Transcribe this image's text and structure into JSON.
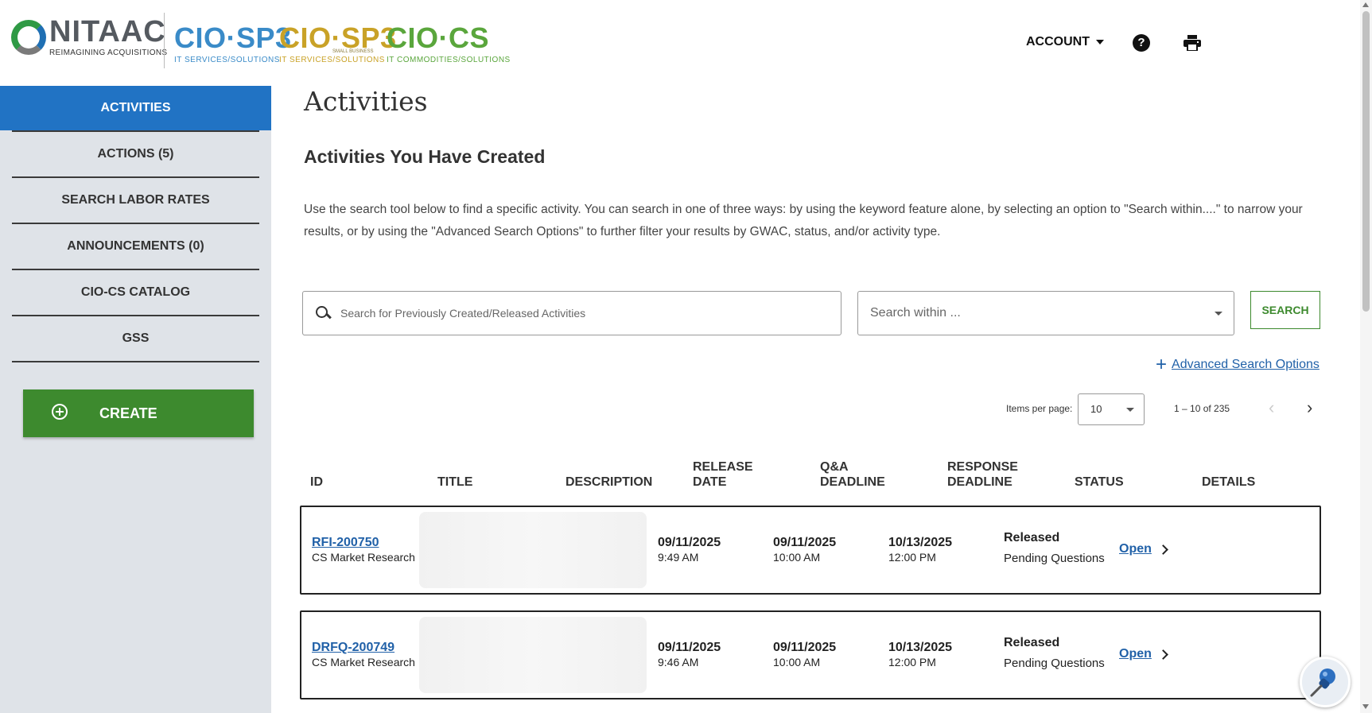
{
  "header": {
    "logo_main": "NITAAC",
    "logo_sub": "REIMAGINING ACQUISITIONS",
    "contracts": [
      {
        "name": "CIO·SP3",
        "tag": "IT SERVICES/SOLUTIONS"
      },
      {
        "name": "CIO·SP3",
        "tag": "IT SERVICES/SOLUTIONS",
        "small_tag": "SMALL BUSINESS"
      },
      {
        "name": "CIO·CS",
        "tag": "IT COMMODITIES/SOLUTIONS"
      }
    ],
    "account_label": "ACCOUNT",
    "help_icon": "?",
    "icons": [
      "help-icon",
      "print-icon",
      "chevron-down-icon"
    ]
  },
  "sidebar": {
    "active": "ACTIVITIES",
    "items": [
      {
        "label": "ACTIONS (5)"
      },
      {
        "label": "SEARCH LABOR RATES"
      },
      {
        "label": "ANNOUNCEMENTS (0)"
      },
      {
        "label": "CIO-CS CATALOG"
      },
      {
        "label": "GSS"
      }
    ],
    "create_label": "CREATE"
  },
  "main": {
    "title": "Activities",
    "section_title": "Activities You Have Created",
    "intro": "Use the search tool below to find a specific activity. You can search in one of three ways: by using the keyword feature alone, by selecting an option to \"Search within....\" to narrow your results, or by using the \"Advanced Search Options\" to further filter your results by GWAC, status, and/or activity type.",
    "search_placeholder": "Search for Previously Created/Released Activities",
    "search_within": "Search within ...",
    "search_button": "SEARCH",
    "advanced_plus": "+",
    "advanced_link": "Advanced Search Options",
    "items_per_page_label": "Items per page:",
    "items_per_page": "10",
    "range": "1 – 10 of 235",
    "prev_glyph": "‹",
    "next_glyph": "›"
  },
  "table": {
    "headers": {
      "id": "ID",
      "title": "TITLE",
      "description": "DESCRIPTION",
      "release_1": "RELEASE",
      "release_2": "DATE",
      "qa_1": "Q&A",
      "qa_2": "DEADLINE",
      "response_1": "RESPONSE",
      "response_2": "DEADLINE",
      "status": "STATUS",
      "details": "DETAILS"
    },
    "rows": [
      {
        "id": "RFI-200750",
        "type": "CS Market Research",
        "release_date": "09/11/2025",
        "release_time": "9:49 AM",
        "qa_date": "09/11/2025",
        "qa_time": "10:00 AM",
        "response_date": "10/13/2025",
        "response_time": "12:00 PM",
        "status": "Released",
        "substatus": "Pending Questions",
        "details": "Open"
      },
      {
        "id": "DRFQ-200749",
        "type": "CS Market Research",
        "release_date": "09/11/2025",
        "release_time": "9:46 AM",
        "qa_date": "09/11/2025",
        "qa_time": "10:00 AM",
        "response_date": "10/13/2025",
        "response_time": "12:00 PM",
        "status": "Released",
        "substatus": "Pending Questions",
        "details": "Open"
      }
    ]
  },
  "colors": {
    "primary_blue": "#2173c4",
    "create_green": "#3d8a2e",
    "link_blue": "#2161a8",
    "sidebar_bg": "#dfe3e8"
  }
}
